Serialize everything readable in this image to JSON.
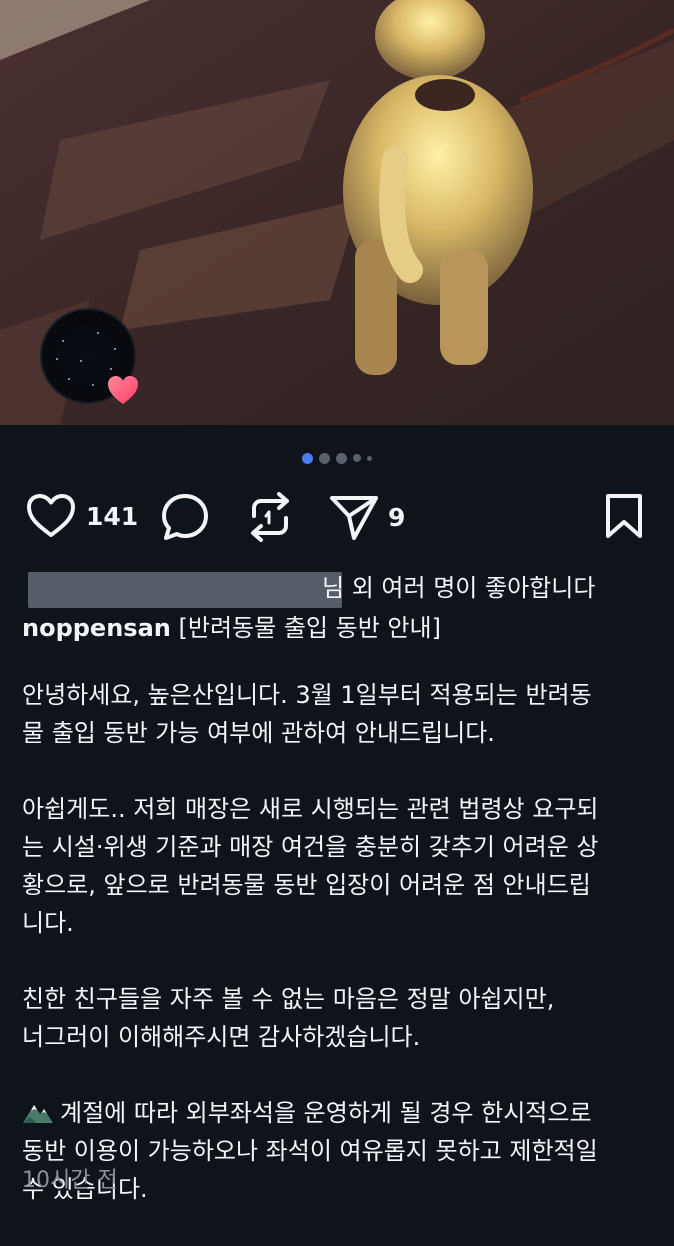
{
  "post": {
    "photo_alt": "dog-photo",
    "carousel": {
      "count": 5,
      "active": 1
    },
    "actions": {
      "likes_count": "141",
      "shares_count": "9"
    },
    "liked_by_suffix": "님 외 여러 명이 좋아합니다",
    "caption": {
      "username": "noppensan",
      "headline": "[반려동물 출입 동반 안내]",
      "paragraphs": [
        "안녕하세요, 높은산입니다. 3월 1일부터 적용되는 반려동\n물 출입 동반 가능 여부에 관하여 안내드립니다.",
        "아쉽게도.. 저희 매장은 새로 시행되는 관련 법령상 요구되\n는 시설·위생 기준과 매장 여건을 충분히 갖추기 어려운 상\n황으로, 앞으로 반려동물 동반 입장이 어려운 점 안내드립\n니다.",
        "친한 친구들을 자주 볼 수 없는 마음은 정말 아쉽지만,\n너그러이 이해해주시면 감사하겠습니다."
      ],
      "last_paragraph": "계절에 따라 외부좌석을 운영하게 될 경우 한시적으로\n동반 이용이 가능하오나 좌석이 여유롭지 못하고 제한적일\n수 있습니다."
    },
    "timestamp": "10시간 전"
  },
  "colors": {
    "background": "#0f141b",
    "text": "#f2f4f7",
    "muted": "#8a9099",
    "active_dot": "#4b7bf5",
    "heart": "#ff4d6d"
  }
}
